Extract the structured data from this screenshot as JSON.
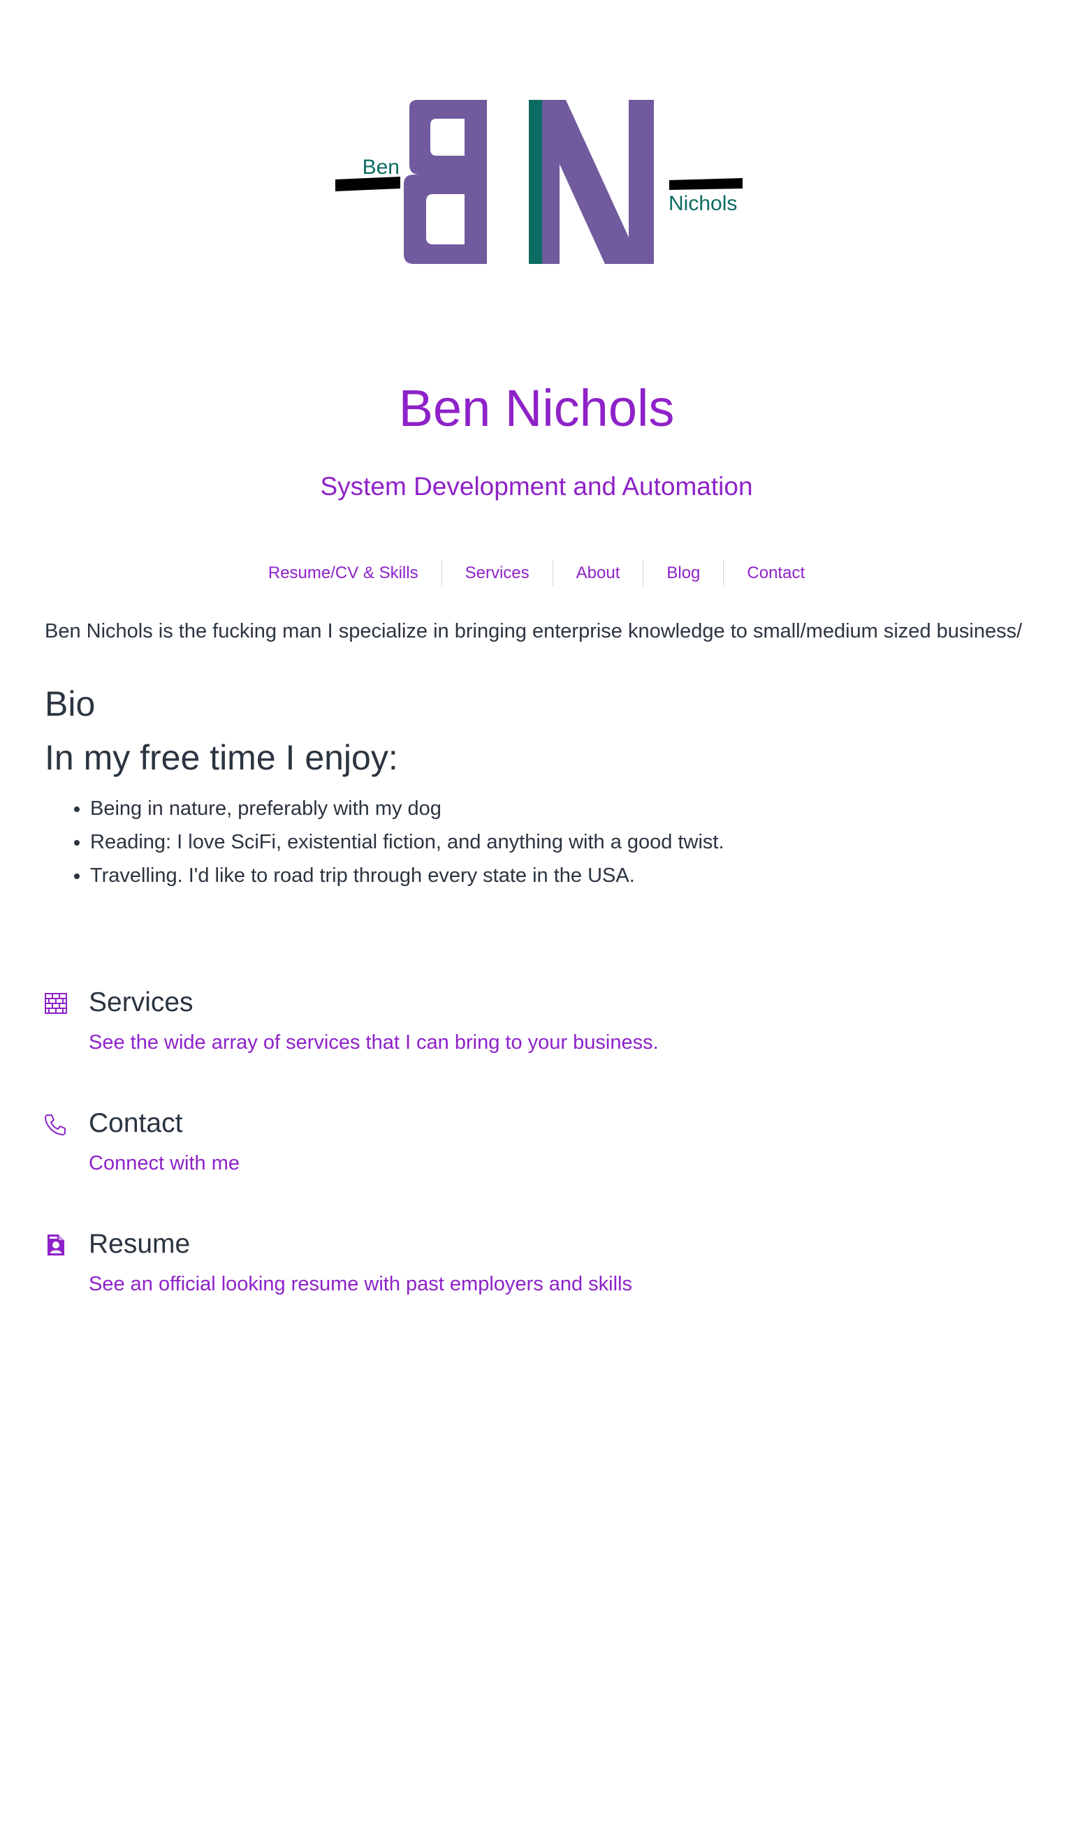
{
  "logo": {
    "first": "Ben",
    "last": "Nichols",
    "colors": {
      "letters": "#715a9e",
      "stripe": "#0c6b63",
      "names": "#0c6b63",
      "bars": "#000000"
    }
  },
  "header": {
    "title": "Ben Nichols",
    "subtitle": "System Development and Automation"
  },
  "nav": {
    "items": [
      "Resume/CV & Skills",
      "Services",
      "About",
      "Blog",
      "Contact"
    ]
  },
  "main": {
    "intro": "Ben Nichols is the fucking man I specialize in bringing enterprise knowledge to small/medium sized business/",
    "bio_heading": "Bio",
    "free_time_heading": "In my free time I enjoy:",
    "hobbies": [
      "Being in nature, preferably with my dog",
      "Reading: I love SciFi, existential fiction, and anything with a good twist.",
      "Travelling. I'd like to road trip through every state in the USA."
    ]
  },
  "features": [
    {
      "icon": "brick-wall-icon",
      "title": "Services",
      "description": "See the wide array of services that I can bring to your business."
    },
    {
      "icon": "phone-icon",
      "title": "Contact",
      "description": "Connect with me"
    },
    {
      "icon": "resume-file-icon",
      "title": "Resume",
      "description": "See an official looking resume with past employers and skills"
    }
  ],
  "colors": {
    "accent": "#8e22c8",
    "text": "#2b3440",
    "background": "#ffffff"
  }
}
